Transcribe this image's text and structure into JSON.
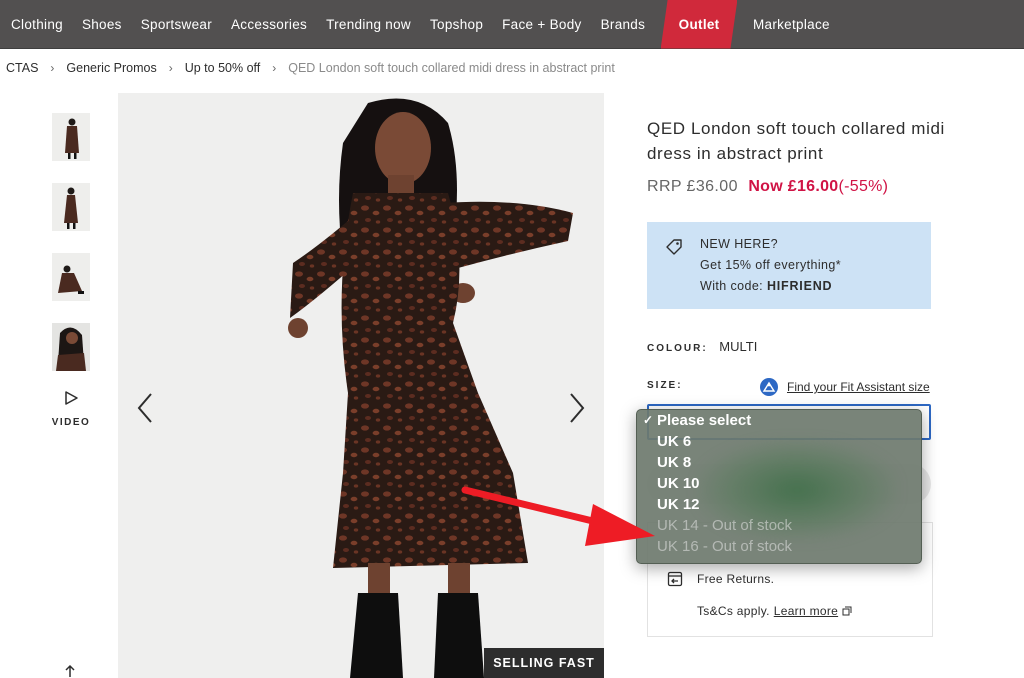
{
  "nav": {
    "items": [
      "Clothing",
      "Shoes",
      "Sportswear",
      "Accessories",
      "Trending now",
      "Topshop",
      "Face + Body",
      "Brands"
    ],
    "outlet": "Outlet",
    "marketplace": "Marketplace"
  },
  "breadcrumb": {
    "items": [
      "CTAS",
      "Generic Promos",
      "Up to 50% off"
    ],
    "separator": "›",
    "current": "QED London soft touch collared midi dress in abstract print"
  },
  "gallery": {
    "video_label": "VIDEO",
    "badge": "SELLING FAST"
  },
  "product": {
    "title": "QED London soft touch collared midi dress in abstract print",
    "rrp": "RRP £36.00",
    "now": "Now £16.00",
    "discount": "(-55%)"
  },
  "promo": {
    "line1": "NEW HERE?",
    "line2": "Get 15% off everything*",
    "line3_prefix": "With code: ",
    "code": "HIFRIEND"
  },
  "colour": {
    "label": "COLOUR:",
    "value": "MULTI"
  },
  "size": {
    "label": "SIZE:",
    "fit_link": "Find your Fit Assistant size",
    "options": [
      {
        "label": "Please select",
        "selected": true,
        "disabled": false
      },
      {
        "label": "UK 6",
        "selected": false,
        "disabled": false
      },
      {
        "label": "UK 8",
        "selected": false,
        "disabled": false
      },
      {
        "label": "UK 10",
        "selected": false,
        "disabled": false
      },
      {
        "label": "UK 12",
        "selected": false,
        "disabled": false
      },
      {
        "label": "UK 14 - Out of stock",
        "selected": false,
        "disabled": true
      },
      {
        "label": "UK 16 - Out of stock",
        "selected": false,
        "disabled": true
      }
    ]
  },
  "delivery": {
    "returns": "Free Returns.",
    "tcs_prefix": "Ts&Cs apply.",
    "learn_more": "Learn more"
  },
  "colors": {
    "nav_bg": "#525050",
    "outlet_red": "#d0293b",
    "sale_red": "#d01345",
    "promo_bg": "#cde2f5",
    "arrow_red": "#ee1c25"
  }
}
